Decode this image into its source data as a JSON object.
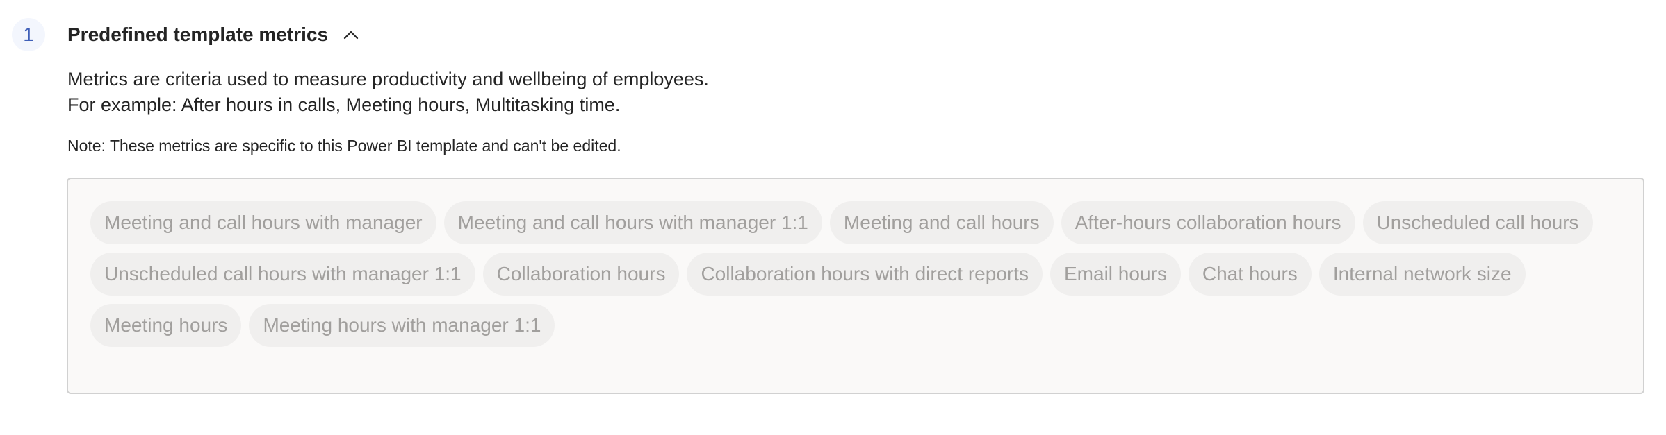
{
  "step": {
    "number": "1"
  },
  "section": {
    "title": "Predefined template metrics",
    "toggle_icon": "chevron-up-icon"
  },
  "description": {
    "line1": "Metrics are criteria used to measure productivity and wellbeing of employees.",
    "line2": "For example: After hours in calls, Meeting hours, Multitasking time."
  },
  "note": "Note: These metrics are specific to this Power BI template and can't be edited.",
  "colors": {
    "badge_bg": "#f3f6fd",
    "badge_text": "#3f5fb8",
    "chip_bg": "#f0efee",
    "chip_text": "#a19f9d",
    "box_bg": "#faf9f8",
    "box_border": "#d1d1d1"
  },
  "metrics": [
    "Meeting and call hours with manager",
    "Meeting and call hours with manager 1:1",
    "Meeting and call hours",
    "After-hours collaboration hours",
    "Unscheduled call hours",
    "Unscheduled call hours with manager 1:1",
    "Collaboration hours",
    "Collaboration hours with direct reports",
    "Email hours",
    "Chat hours",
    "Internal network size",
    "Meeting hours",
    "Meeting hours with manager 1:1"
  ]
}
